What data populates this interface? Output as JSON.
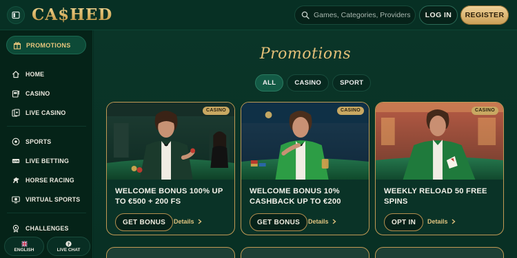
{
  "header": {
    "logo_text": "CA$HED",
    "search": {
      "placeholder": "Games, Categories, Providers"
    },
    "login_label": "LOG IN",
    "register_label": "REGISTER"
  },
  "sidebar": {
    "promotions_label": "PROMOTIONS",
    "groups": [
      [
        {
          "label": "HOME",
          "icon": "home-icon"
        },
        {
          "label": "CASINO",
          "icon": "slot-machine-icon"
        },
        {
          "label": "LIVE CASINO",
          "icon": "live-cards-icon"
        }
      ],
      [
        {
          "label": "SPORTS",
          "icon": "soccer-ball-icon"
        },
        {
          "label": "LIVE BETTING",
          "icon": "live-badge-icon"
        },
        {
          "label": "HORSE RACING",
          "icon": "horse-icon"
        },
        {
          "label": "VIRTUAL SPORTS",
          "icon": "virtual-sports-icon"
        }
      ],
      [
        {
          "label": "CHALLENGES",
          "icon": "trophy-icon"
        }
      ]
    ],
    "language_label": "ENGLISH",
    "chat_label": "LIVE CHAT"
  },
  "main": {
    "title": "Promotions",
    "filters": [
      {
        "label": "ALL",
        "active": true
      },
      {
        "label": "CASINO",
        "active": false
      },
      {
        "label": "SPORT",
        "active": false
      }
    ],
    "cards": [
      {
        "badge": "CASINO",
        "title": "WELCOME BONUS 100% UP TO €500 + 200 FS",
        "cta": "GET BONUS",
        "details": "Details"
      },
      {
        "badge": "CASINO",
        "title": "WELCOME BONUS 10% CASHBACK UP TO €200",
        "cta": "GET BONUS",
        "details": "Details"
      },
      {
        "badge": "CASINO",
        "title": "WEEKLY RELOAD 50 FREE SPINS",
        "cta": "OPT IN",
        "details": "Details"
      }
    ]
  },
  "colors": {
    "background": "#062a20",
    "accent_gold": "#e3bf78",
    "card_border": "#c29a55",
    "active_filter": "#135a45"
  }
}
